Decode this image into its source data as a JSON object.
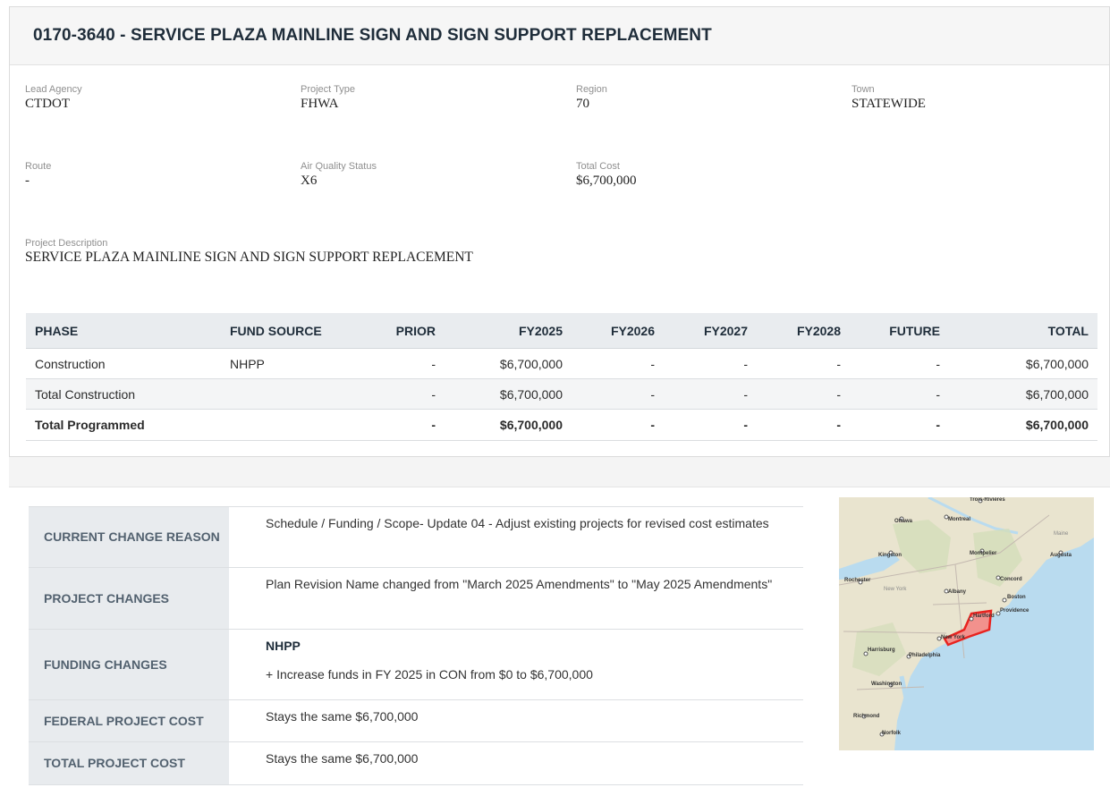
{
  "project": {
    "title": "0170-3640 - SERVICE PLAZA MAINLINE SIGN AND SIGN SUPPORT REPLACEMENT"
  },
  "details": {
    "lead_agency": {
      "label": "Lead Agency",
      "value": "CTDOT"
    },
    "project_type": {
      "label": "Project Type",
      "value": "FHWA"
    },
    "region": {
      "label": "Region",
      "value": "70"
    },
    "town": {
      "label": "Town",
      "value": "STATEWIDE"
    },
    "route": {
      "label": "Route",
      "value": "-"
    },
    "air_quality": {
      "label": "Air Quality Status",
      "value": "X6"
    },
    "total_cost": {
      "label": "Total Cost",
      "value": "$6,700,000"
    },
    "description": {
      "label": "Project Description",
      "value": "SERVICE PLAZA MAINLINE SIGN AND SIGN SUPPORT REPLACEMENT"
    }
  },
  "funding_table": {
    "headers": [
      "PHASE",
      "FUND SOURCE",
      "PRIOR",
      "FY2025",
      "FY2026",
      "FY2027",
      "FY2028",
      "FUTURE",
      "TOTAL"
    ],
    "rows": [
      [
        "Construction",
        "NHPP",
        "-",
        "$6,700,000",
        "-",
        "-",
        "-",
        "-",
        "$6,700,000"
      ],
      [
        "Total Construction",
        "",
        "-",
        "$6,700,000",
        "-",
        "-",
        "-",
        "-",
        "$6,700,000"
      ],
      [
        "Total Programmed",
        "",
        "-",
        "$6,700,000",
        "-",
        "-",
        "-",
        "-",
        "$6,700,000"
      ]
    ]
  },
  "changes": {
    "current_change_reason": {
      "label": "CURRENT CHANGE REASON",
      "value": "Schedule / Funding / Scope- Update 04 - Adjust existing projects for revised cost estimates"
    },
    "project_changes": {
      "label": "PROJECT CHANGES",
      "value": "Plan Revision Name changed from \"March 2025 Amendments\" to \"May 2025 Amendments\""
    },
    "funding_changes": {
      "label": "FUNDING CHANGES",
      "source": "NHPP",
      "value": "+ Increase funds in FY 2025 in CON from $0 to $6,700,000"
    },
    "federal_project_cost": {
      "label": "FEDERAL PROJECT COST",
      "value": "Stays the same $6,700,000"
    },
    "total_project_cost": {
      "label": "TOTAL PROJECT COST",
      "value": "Stays the same $6,700,000"
    }
  },
  "map": {
    "labels": [
      "Trois-Rivières",
      "Ottawa",
      "Montreal",
      "Kingston",
      "Montpelier",
      "Augusta",
      "Maine",
      "Rochester",
      "New York",
      "Concord",
      "Albany",
      "Boston",
      "Providence",
      "Hartford",
      "New York",
      "Harrisburg",
      "Philadelphia",
      "Washington",
      "Richmond",
      "Norfolk"
    ],
    "colors": {
      "land": "#e9e4cf",
      "water": "#b9dbef",
      "highlight": "#e8231f"
    }
  }
}
